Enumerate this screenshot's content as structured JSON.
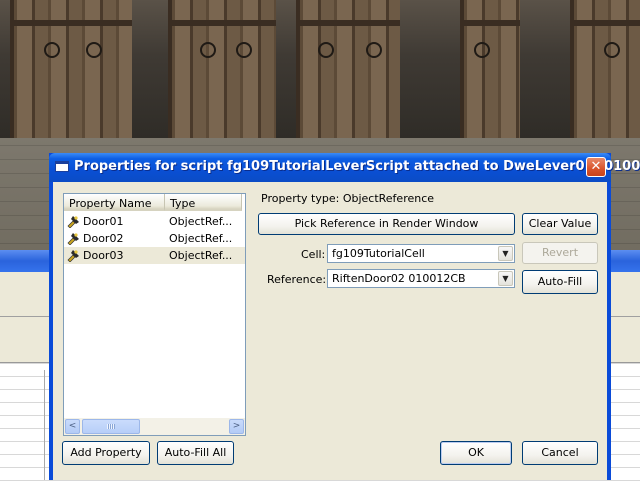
{
  "dialog": {
    "title": "Properties for script fg109TutorialLeverScript attached to DweLever01 (01001...",
    "close_glyph": "✕"
  },
  "property_list": {
    "columns": [
      "Property Name",
      "Type"
    ],
    "rows": [
      {
        "name": "Door01",
        "type": "ObjectRef...",
        "icon": "property-script-icon",
        "selected": false
      },
      {
        "name": "Door02",
        "type": "ObjectRef...",
        "icon": "property-script-icon",
        "selected": false
      },
      {
        "name": "Door03",
        "type": "ObjectRef...",
        "icon": "property-script-icon",
        "selected": true
      }
    ],
    "scroll_left_glyph": "<",
    "scroll_right_glyph": ">"
  },
  "details": {
    "property_type": "Property type: ObjectReference",
    "pick_reference_label": "Pick Reference in Render Window",
    "clear_value_label": "Clear Value",
    "revert_label": "Revert",
    "auto_fill_label": "Auto-Fill",
    "cell_label": "Cell:",
    "cell_value": "fg109TutorialCell",
    "reference_label": "Reference:",
    "reference_value": "RiftenDoor02 010012CB",
    "dropdown_glyph": "▼"
  },
  "footer": {
    "add_property_label": "Add Property",
    "auto_fill_all_label": "Auto-Fill All",
    "ok_label": "OK",
    "cancel_label": "Cancel"
  },
  "colors": {
    "titlebar": "#0a4fd4",
    "dialog_face": "#ece9d8",
    "close_button": "#d9542b"
  }
}
